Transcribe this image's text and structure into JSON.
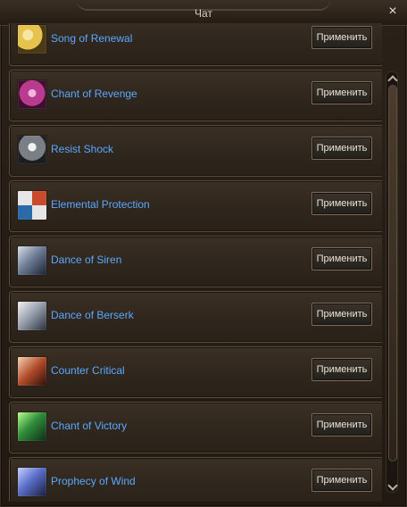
{
  "window": {
    "title": "Чат",
    "close_symbol": "×"
  },
  "list": {
    "apply_label": "Применить",
    "items": [
      {
        "name": "Song of Renewal",
        "icon": "song-of-renewal-icon",
        "icon_color": "#e6c24e"
      },
      {
        "name": "Chant of Revenge",
        "icon": "chant-of-revenge-icon",
        "icon_color": "#b83b8f"
      },
      {
        "name": "Resist Shock",
        "icon": "resist-shock-icon",
        "icon_color": "#7a7f86"
      },
      {
        "name": "Elemental Protection",
        "icon": "elemental-protection-icon",
        "icon_color": "#c84b2b"
      },
      {
        "name": "Dance of Siren",
        "icon": "dance-of-siren-icon",
        "icon_color": "#6f7f98"
      },
      {
        "name": "Dance of Berserk",
        "icon": "dance-of-berserk-icon",
        "icon_color": "#9aa2b0"
      },
      {
        "name": "Counter Critical",
        "icon": "counter-critical-icon",
        "icon_color": "#b04a2a"
      },
      {
        "name": "Chant of Victory",
        "icon": "chant-of-victory-icon",
        "icon_color": "#2f8c3a"
      },
      {
        "name": "Prophecy of Wind",
        "icon": "prophecy-of-wind-icon",
        "icon_color": "#5b6fc9"
      }
    ]
  }
}
